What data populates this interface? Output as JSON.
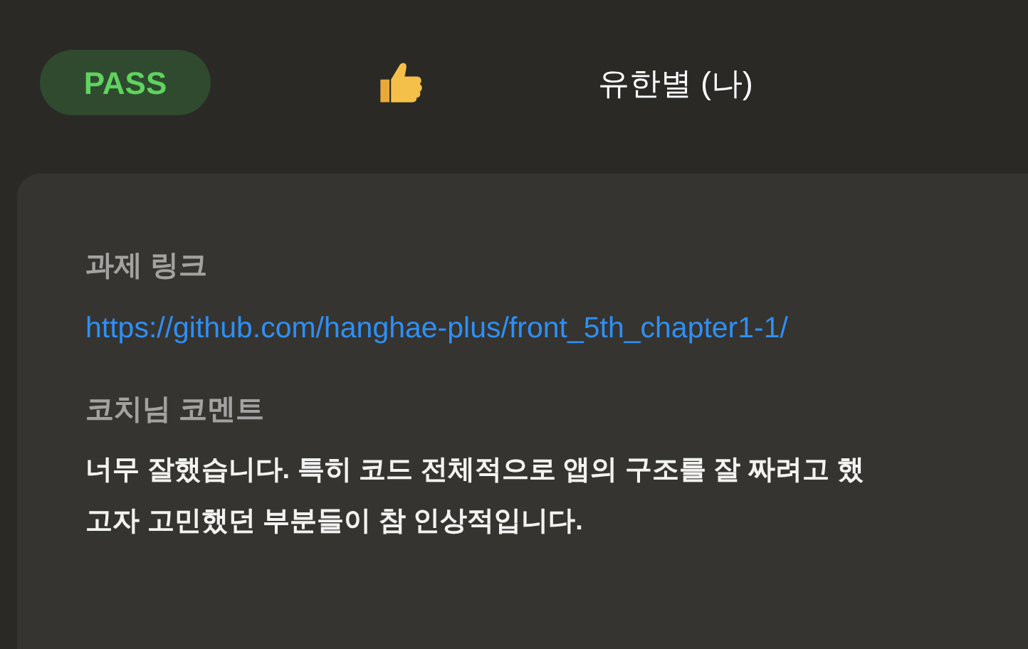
{
  "header": {
    "badge": "PASS",
    "author": "유한별 (나)"
  },
  "card": {
    "sections": [
      {
        "label": "과제 링크",
        "kind": "link",
        "lines": [
          "https://github.com/hanghae-plus/front_5th_chapter1-1/"
        ]
      },
      {
        "label": "코치님 코멘트",
        "kind": "text",
        "lines": [
          "너무 잘했습니다. 특히 코드 전체적으로 앱의 구조를 잘 짜려고 했",
          "고자 고민했던 부분들이 참 인상적입니다."
        ]
      }
    ]
  }
}
